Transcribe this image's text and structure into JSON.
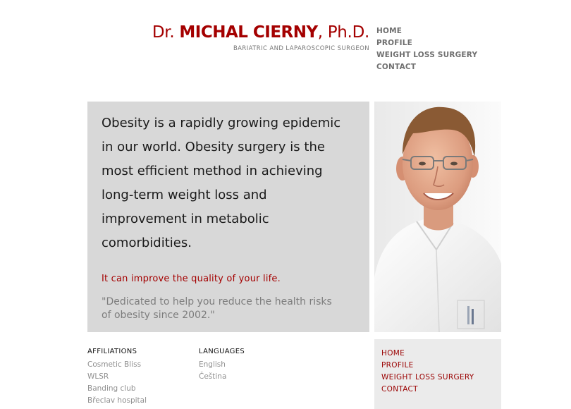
{
  "header": {
    "name_prefix": "Dr.",
    "name_main": "MICHAL CIERNY",
    "name_suffix": ", Ph.D.",
    "tagline": "BARIATRIC AND LAPAROSCOPIC SURGEON"
  },
  "top_nav": [
    {
      "label": "HOME"
    },
    {
      "label": "PROFILE"
    },
    {
      "label": "WEIGHT LOSS SURGERY"
    },
    {
      "label": "CONTACT"
    }
  ],
  "hero": {
    "text": "Obesity is a rapidly growing epidemic in our world. Obesity surgery is the most efficient method in achieving long-term weight loss and improvement in metabolic comorbidities.",
    "highlight": "It can improve the quality of your life.",
    "quote": "\"Dedicated to help you reduce the health risks of obesity since 2002.\""
  },
  "affiliations": {
    "title": "AFFILIATIONS",
    "items": [
      "Cosmetic Bliss",
      "WLSR",
      "Banding club",
      "Břeclav hospital"
    ]
  },
  "languages": {
    "title": "LANGUAGES",
    "items": [
      "English",
      "Čeština"
    ]
  },
  "bottom_nav": [
    {
      "label": "HOME"
    },
    {
      "label": "PROFILE"
    },
    {
      "label": "WEIGHT LOSS SURGERY"
    },
    {
      "label": "CONTACT"
    }
  ],
  "colors": {
    "brand_red": "#a40000",
    "hero_bg": "#d8d8d8",
    "nav_gray": "#6f6f6f",
    "bottom_nav_bg": "#ebebeb"
  }
}
